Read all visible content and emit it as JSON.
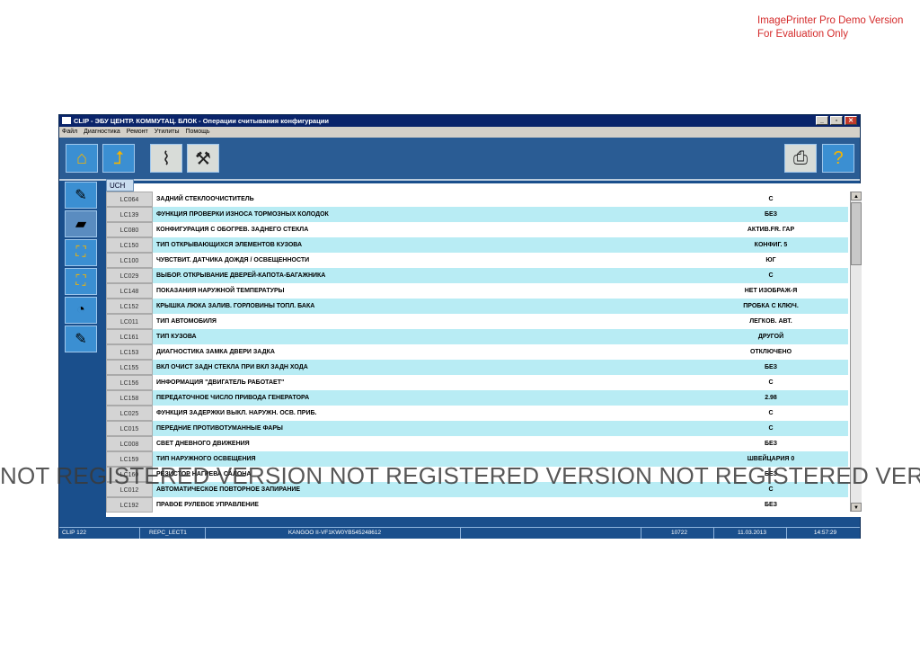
{
  "watermark": {
    "line1": "ImagePrinter Pro Demo Version",
    "line2": "For Evaluation Only",
    "banner": "NOT REGISTERED VERSION NOT REGISTERED VERSION NOT REGISTERED VERSION"
  },
  "window": {
    "title": "CLIP - ЭБУ ЦЕНТР. КОММУТАЦ. БЛОК - Операции считывания конфигурации",
    "controls": [
      "_",
      "▫",
      "✕"
    ]
  },
  "menu": [
    "Файл",
    "Диагностика",
    "Ремонт",
    "Утилиты",
    "Помощь"
  ],
  "tab_label": "UCH",
  "rows": [
    {
      "code": "LC064",
      "label": "ЗАДНИЙ СТЕКЛООЧИСТИТЕЛЬ",
      "value": "С"
    },
    {
      "code": "LC139",
      "label": "ФУНКЦИЯ ПРОВЕРКИ ИЗНОСА ТОРМОЗНЫХ КОЛОДОК",
      "value": "БЕЗ"
    },
    {
      "code": "LC080",
      "label": "КОНФИГУРАЦИЯ С ОБОГРЕВ. ЗАДНЕГО СТЕКЛА",
      "value": "АКТИВ.FR. ГАР"
    },
    {
      "code": "LC150",
      "label": "ТИП ОТКРЫВАЮЩИХСЯ ЭЛЕМЕНТОВ КУЗОВА",
      "value": "КОНФИГ. 5"
    },
    {
      "code": "LC100",
      "label": "ЧУВСТВИТ. ДАТЧИКА ДОЖДЯ / ОСВЕЩЕННОСТИ",
      "value": "ЮГ"
    },
    {
      "code": "LC029",
      "label": "ВЫБОР. ОТКРЫВАНИЕ ДВЕРЕЙ-КАПОТА-БАГАЖНИКА",
      "value": "С"
    },
    {
      "code": "LC148",
      "label": "ПОКАЗАНИЯ НАРУЖНОЙ ТЕМПЕРАТУРЫ",
      "value": "НЕТ ИЗОБРАЖ-Я"
    },
    {
      "code": "LC152",
      "label": "КРЫШКА ЛЮКА ЗАЛИВ. ГОРЛОВИНЫ ТОПЛ. БАКА",
      "value": "ПРОБКА С КЛЮЧ."
    },
    {
      "code": "LC011",
      "label": "ТИП АВТОМОБИЛЯ",
      "value": "ЛЕГКОВ. АВТ."
    },
    {
      "code": "LC161",
      "label": "ТИП КУЗОВА",
      "value": "ДРУГОЙ"
    },
    {
      "code": "LC153",
      "label": "ДИАГНОСТИКА ЗАМКА ДВЕРИ ЗАДКА",
      "value": "ОТКЛЮЧЕНО"
    },
    {
      "code": "LC155",
      "label": "ВКЛ ОЧИСТ ЗАДН СТЕКЛА ПРИ ВКЛ ЗАДН ХОДА",
      "value": "БЕЗ"
    },
    {
      "code": "LC156",
      "label": "ИНФОРМАЦИЯ \"ДВИГАТЕЛЬ РАБОТАЕТ\"",
      "value": "С"
    },
    {
      "code": "LC158",
      "label": "ПЕРЕДАТОЧНОЕ ЧИСЛО ПРИВОДА ГЕНЕРАТОРА",
      "value": "2.98"
    },
    {
      "code": "LC025",
      "label": "ФУНКЦИЯ ЗАДЕРЖКИ ВЫКЛ. НАРУЖН. ОСВ. ПРИБ.",
      "value": "С"
    },
    {
      "code": "LC015",
      "label": "ПЕРЕДНИЕ ПРОТИВОТУМАННЫЕ ФАРЫ",
      "value": "С"
    },
    {
      "code": "LC008",
      "label": "СВЕТ ДНЕВНОГО ДВИЖЕНИЯ",
      "value": "БЕЗ"
    },
    {
      "code": "LC159",
      "label": "ТИП НАРУЖНОГО ОСВЕЩЕНИЯ",
      "value": "ШВЕЙЦАРИЯ 0"
    },
    {
      "code": "LC160",
      "label": "РЕЗИСТОР НАГРЕВА САЛОНА",
      "value": "БЕЗ"
    },
    {
      "code": "LC012",
      "label": "АВТОМАТИЧЕСКОЕ ПОВТОРНОЕ ЗАПИРАНИЕ",
      "value": "С"
    },
    {
      "code": "LC192",
      "label": "ПРАВОЕ РУЛЕВОЕ УПРАВЛЕНИЕ",
      "value": "БЕЗ"
    }
  ],
  "status": {
    "version": "CLIP 122",
    "mode": "REPC_LECT1",
    "vehicle": "KANGOO II-VF1KW0YB545248612",
    "code": "10722",
    "date": "11.03.2013",
    "time": "14:57:29"
  }
}
